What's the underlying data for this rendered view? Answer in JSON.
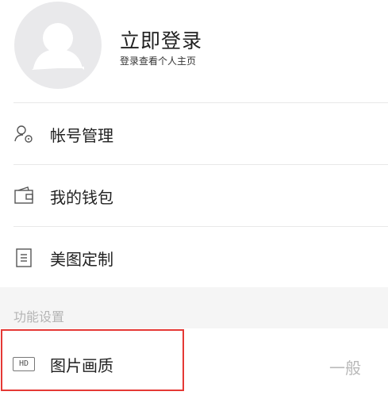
{
  "profile": {
    "login_title": "立即登录",
    "login_subtitle": "登录查看个人主页"
  },
  "menu": [
    {
      "label": "帐号管理",
      "icon": "user-settings-icon"
    },
    {
      "label": "我的钱包",
      "icon": "wallet-icon"
    },
    {
      "label": "美图定制",
      "icon": "document-icon"
    }
  ],
  "section": {
    "title": "功能设置"
  },
  "settings": {
    "image_quality": {
      "label": "图片画质",
      "value": "一般",
      "badge": "HD",
      "icon": "hd-icon"
    }
  },
  "colors": {
    "highlight": "#e53935",
    "avatar_bg": "#e9e9eb"
  }
}
